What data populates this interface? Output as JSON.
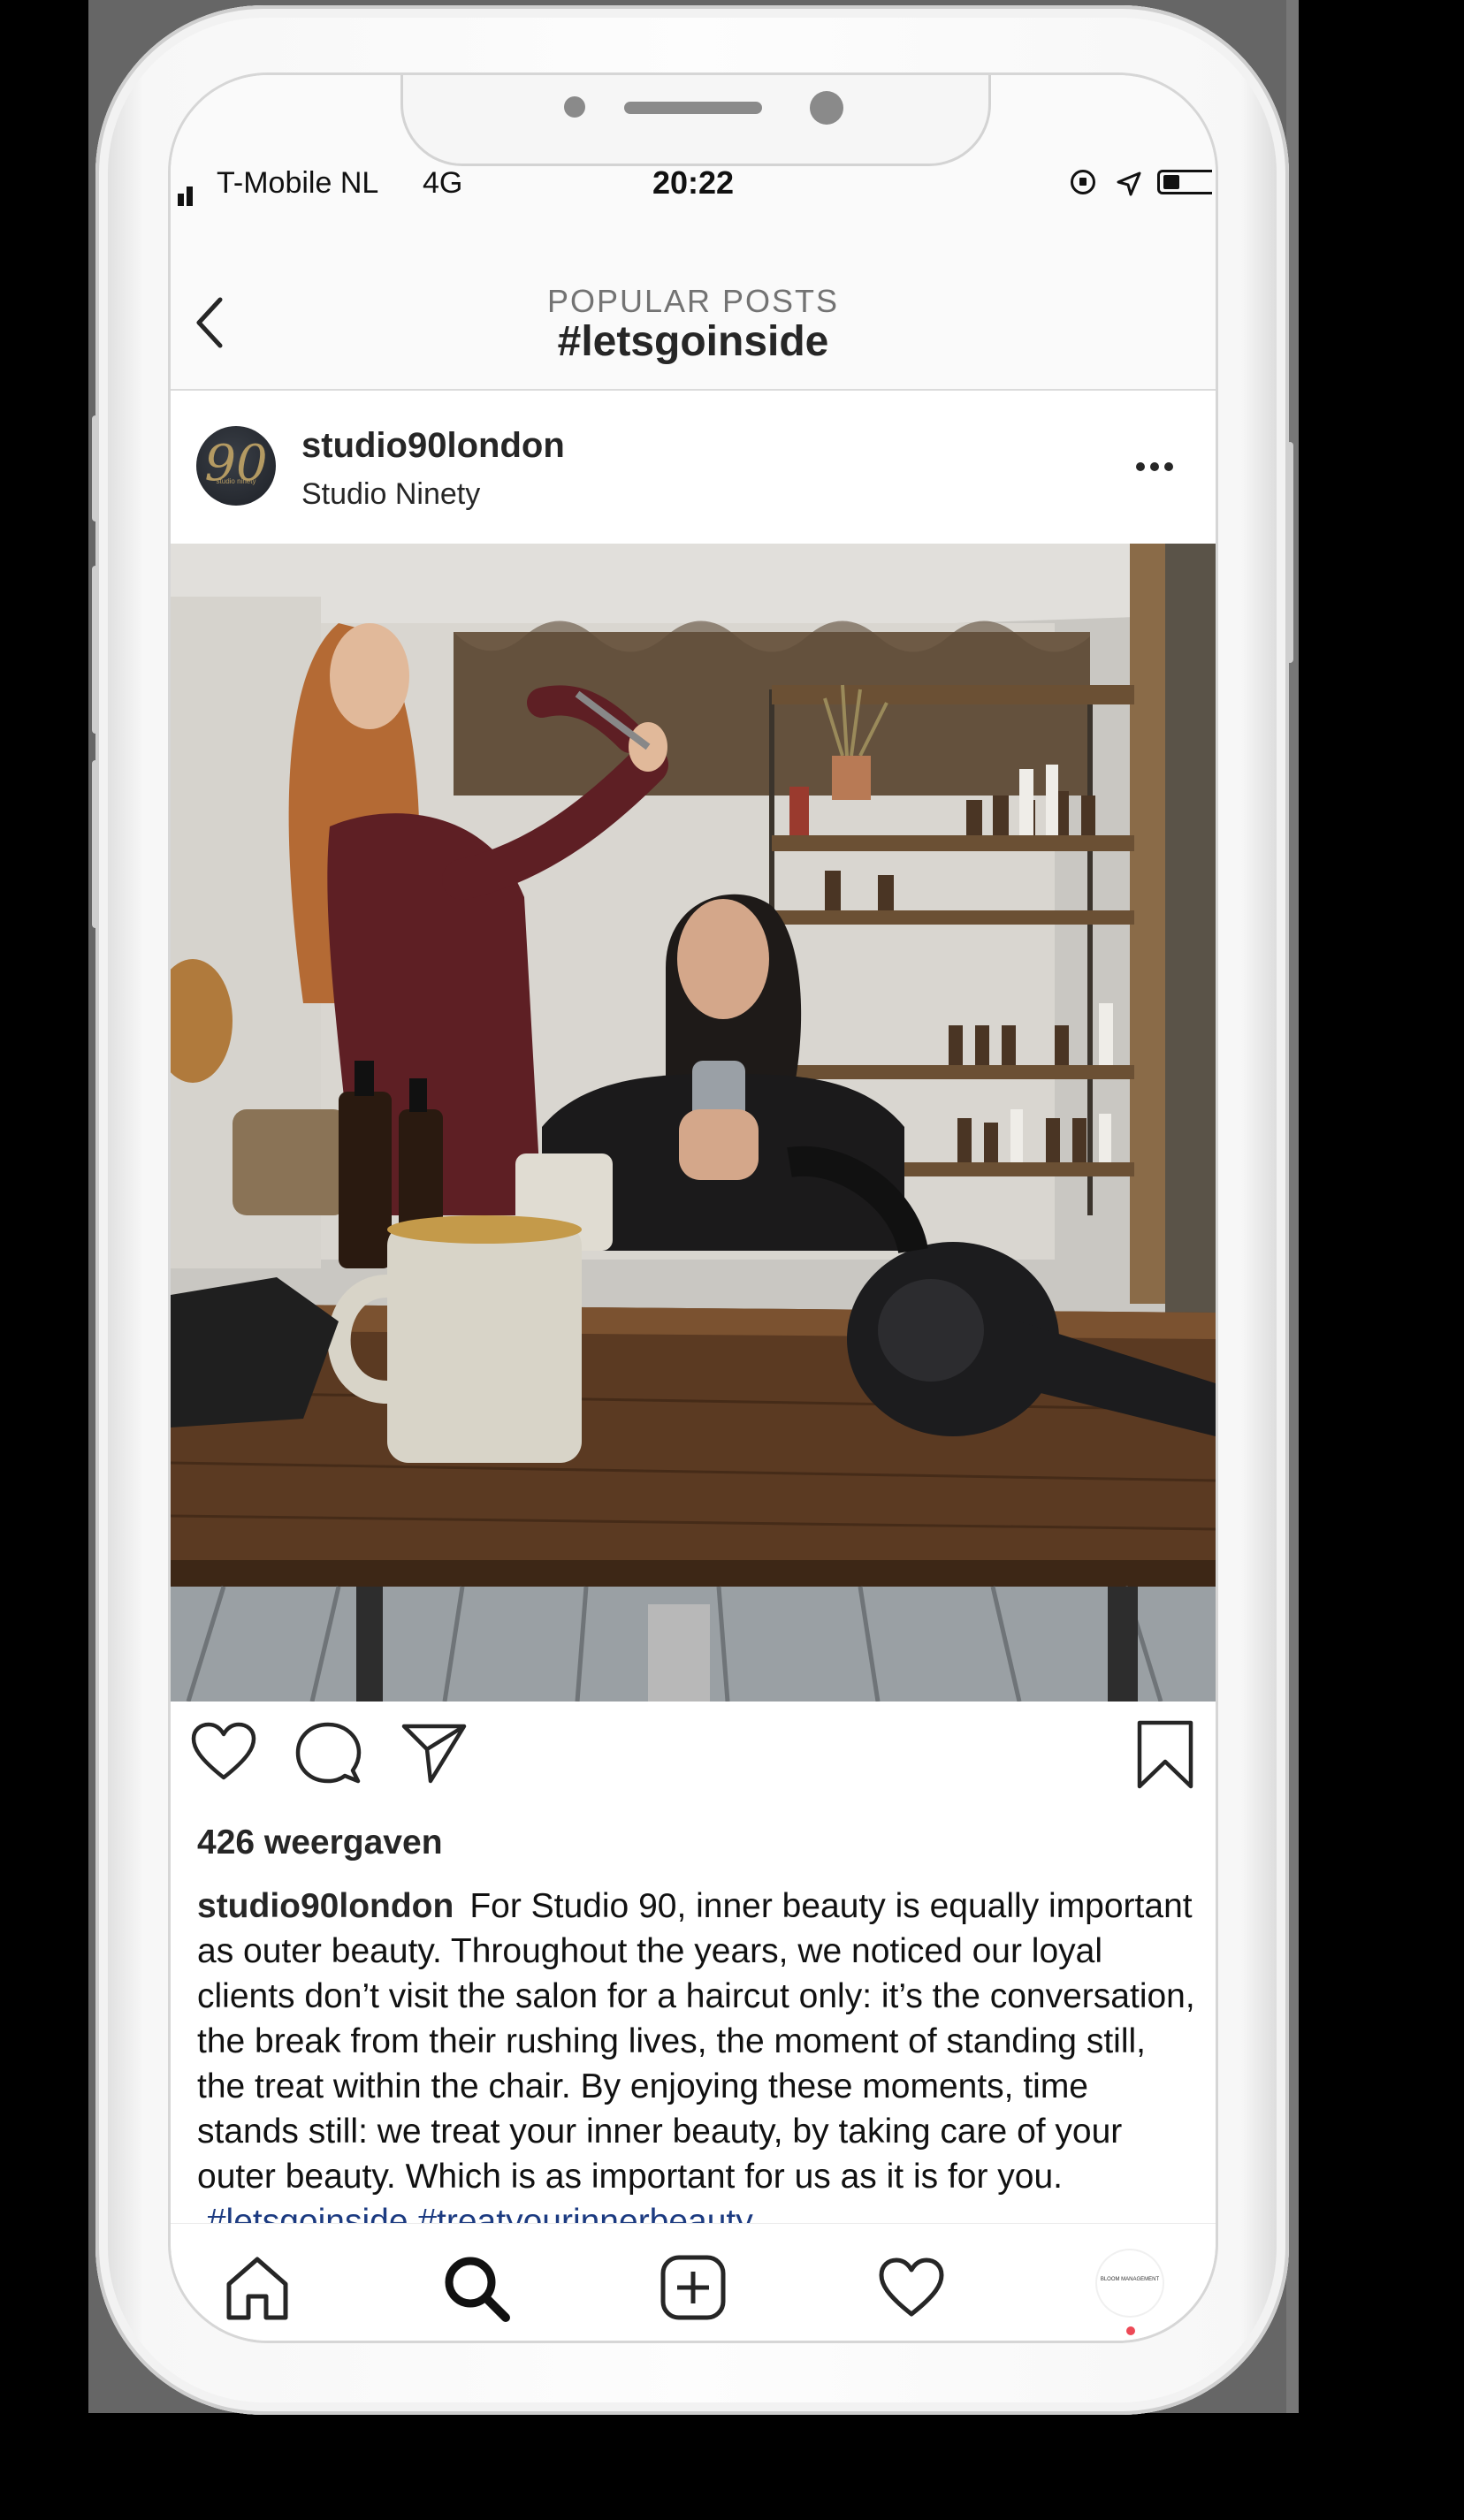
{
  "status_bar": {
    "carrier": "T-Mobile NL",
    "network": "4G",
    "time": "20:22"
  },
  "header": {
    "subtitle": "POPULAR POSTS",
    "title": "#letsgoinside"
  },
  "post": {
    "avatar_text": "90",
    "avatar_small_text": "studio ninety",
    "username": "studio90london",
    "location": "Studio Ninety",
    "views": "426 weergaven",
    "caption_username": "studio90london",
    "caption_text": "For Studio 90, inner beauty is equally important as outer beauty. Throughout the years, we noticed our loyal clients don’t visit the salon for a haircut only: it’s the conversation, the break from their rushing lives, the moment of standing still, the treat within the chair. By enjoying these moments, time stands still: we treat your inner beauty, by taking care of your outer beauty. Which is as important for us as it is for you.",
    "hashtags": [
      "#letsgoinside",
      "#treatyourinnerbeauty"
    ],
    "hashtag_color": "#1c3b81"
  },
  "actions": [
    "heart-icon",
    "comment-icon",
    "share-icon",
    "bookmark-icon"
  ],
  "tab_bar": {
    "items": [
      "home-icon",
      "search-icon",
      "add-post-icon",
      "activity-heart-icon",
      "profile-avatar"
    ],
    "profile_text": "BLOOM MANAGEMENT",
    "notification_color": "#ed4956"
  }
}
